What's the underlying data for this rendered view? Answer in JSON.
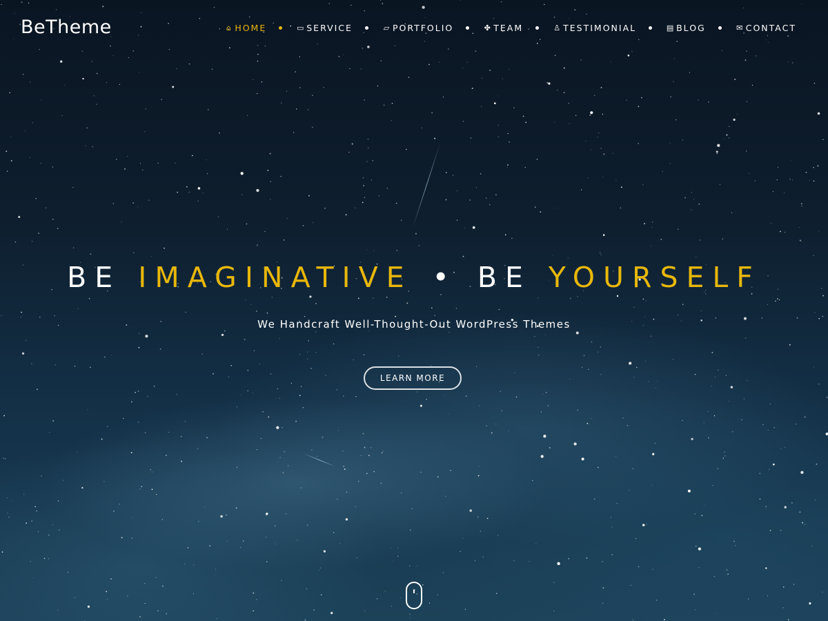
{
  "header": {
    "logo": "BeTheme",
    "nav": [
      {
        "label": "HOME",
        "icon": "home-icon",
        "glyph": "⌂",
        "active": true
      },
      {
        "label": "SERVICE",
        "icon": "laptop-icon",
        "glyph": "▭",
        "active": false
      },
      {
        "label": "PORTFOLIO",
        "icon": "folder-icon",
        "glyph": "▱",
        "active": false
      },
      {
        "label": "TEAM",
        "icon": "users-icon",
        "glyph": "✤",
        "active": false
      },
      {
        "label": "TESTIMONIAL",
        "icon": "thumbs-up-icon",
        "glyph": "♙",
        "active": false
      },
      {
        "label": "BLOG",
        "icon": "newspaper-icon",
        "glyph": "▤",
        "active": false
      },
      {
        "label": "CONTACT",
        "icon": "envelope-icon",
        "glyph": "✉",
        "active": false
      }
    ]
  },
  "hero": {
    "title_part1": "BE",
    "title_accent1": "IMAGINATIVE",
    "title_separator": "•",
    "title_part2": "BE",
    "title_accent2": "YOURSELF",
    "subtitle": "We Handcraft Well-Thought-Out WordPress Themes",
    "button_label": "LEARN MORE",
    "scroll_icon": "mouse-scroll-icon"
  },
  "colors": {
    "accent": "#e8b70a",
    "text": "#ffffff",
    "background": "#0e1e2e"
  }
}
